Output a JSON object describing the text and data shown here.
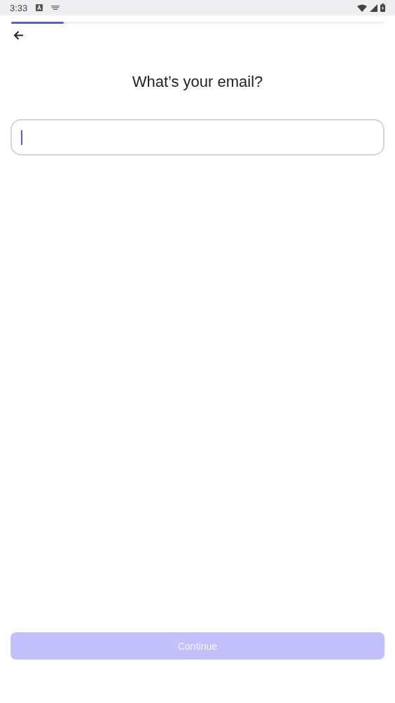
{
  "status_bar": {
    "time": "3:33"
  },
  "progress": {
    "level": 0.14
  },
  "title": "What’s your email?",
  "email_field": {
    "focused": true
  },
  "continue_button": {
    "label": "Continue",
    "disabled": true
  }
}
